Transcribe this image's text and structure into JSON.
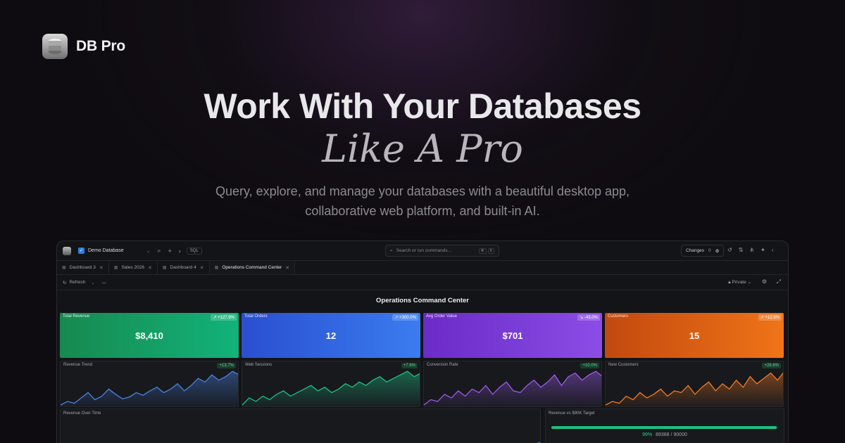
{
  "brand": {
    "name": "DB Pro"
  },
  "hero": {
    "title": "Work With Your Databases",
    "subtitle": "Like A Pro",
    "desc_line1": "Query, explore, and manage your databases with a beautiful desktop app,",
    "desc_line2": "collaborative web platform, and built-in AI."
  },
  "app": {
    "topbar": {
      "database": "Demo Database",
      "sql_label": "SQL",
      "search_placeholder": "Search or run commands...",
      "kbd": [
        "⌘",
        "K"
      ],
      "changes_label": "Changes",
      "changes_count": "0"
    },
    "tabs": [
      {
        "label": "Dashboard 3"
      },
      {
        "label": "Sales 2026"
      },
      {
        "label": "Dashboard 4"
      },
      {
        "label": "Operations Command Center"
      }
    ],
    "toolbar": {
      "refresh": "Refresh",
      "visibility": "Private"
    },
    "dashboard_title": "Operations Command Center",
    "kpis": [
      {
        "label": "Total Revenue",
        "value": "$8,410",
        "change": "↗ +127.9%",
        "color_from": "#17894f",
        "color_to": "#12b37a"
      },
      {
        "label": "Total Orders",
        "value": "12",
        "change": "↗ +300.0%",
        "color_from": "#2a4fcf",
        "color_to": "#3b7cf0"
      },
      {
        "label": "Avg Order Value",
        "value": "$701",
        "change": "↘ -43.0%",
        "color_from": "#6a2bc6",
        "color_to": "#8b4de6"
      },
      {
        "label": "Customers",
        "value": "15",
        "change": "↗ +12.5%",
        "color_from": "#c2490f",
        "color_to": "#f07418"
      }
    ],
    "sparks": [
      {
        "label": "Revenue Trend",
        "change": "+13.7%",
        "color": "#4a82e0",
        "values": [
          10,
          14,
          12,
          18,
          24,
          16,
          20,
          28,
          22,
          17,
          19,
          24,
          21,
          26,
          30,
          24,
          28,
          34,
          26,
          32,
          40,
          36,
          44,
          38,
          42,
          48,
          44
        ]
      },
      {
        "label": "Web Sessions",
        "change": "+7.6%",
        "color": "#1fbf82",
        "values": [
          8,
          16,
          12,
          18,
          14,
          20,
          24,
          18,
          22,
          26,
          30,
          24,
          28,
          22,
          26,
          32,
          28,
          34,
          30,
          36,
          40,
          34,
          38,
          42,
          46,
          40,
          44
        ]
      },
      {
        "label": "Conversion Rate",
        "change": "+10.0%",
        "color": "#9a5ae6",
        "values": [
          8,
          14,
          12,
          20,
          16,
          24,
          18,
          26,
          22,
          30,
          20,
          28,
          34,
          24,
          22,
          30,
          36,
          28,
          34,
          42,
          30,
          40,
          44,
          36,
          42,
          46,
          40
        ]
      },
      {
        "label": "New Customers",
        "change": "+28.6%",
        "color": "#f07a24",
        "values": [
          10,
          14,
          12,
          20,
          16,
          24,
          18,
          22,
          28,
          20,
          26,
          24,
          32,
          22,
          30,
          36,
          26,
          34,
          28,
          38,
          30,
          42,
          34,
          40,
          46,
          38,
          48
        ]
      }
    ],
    "bottom": {
      "rot_label": "Revenue Over Time",
      "target_label": "Revenue vs $90K Target",
      "target_pct": "99%",
      "target_readout": "89388 / 90000",
      "target_fraction": 0.993
    }
  }
}
